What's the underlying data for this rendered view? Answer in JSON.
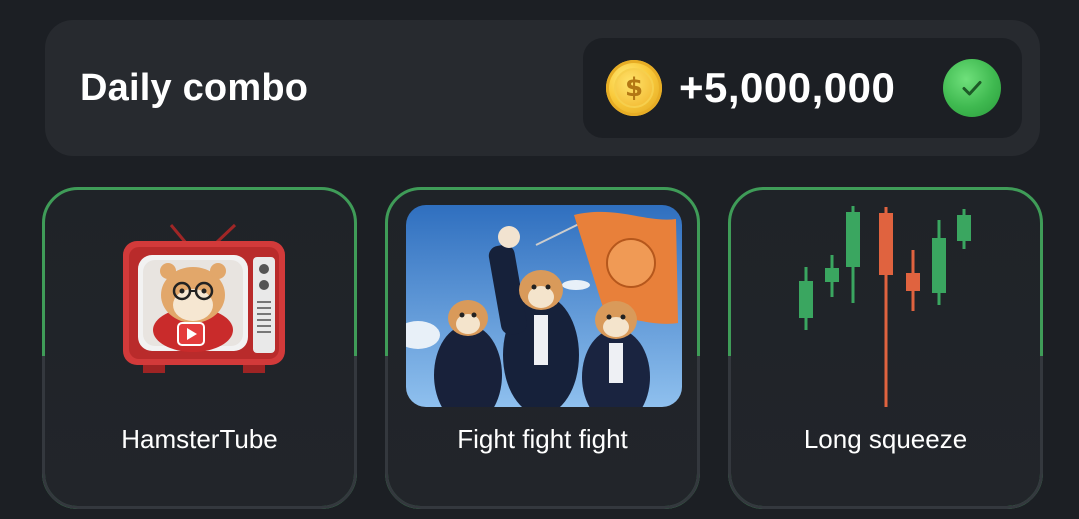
{
  "header": {
    "title": "Daily combo",
    "reward_amount": "+5,000,000",
    "coin_symbol": "$",
    "check_icon": "check-icon"
  },
  "cards": [
    {
      "label": "HamsterTube",
      "icon": "hamster-tv-image"
    },
    {
      "label": "Fight fight fight",
      "icon": "hamsters-flag-photo"
    },
    {
      "label": "Long squeeze",
      "icon": "candlestick-chart-image"
    }
  ],
  "colors": {
    "background": "#1c1f24",
    "panel": "#272a2f",
    "card_border_active": "#3f9c58",
    "check_green": "#3fb950",
    "coin_gold": "#f9c93a",
    "candle_green": "#3aa660",
    "candle_red": "#e0633f"
  }
}
